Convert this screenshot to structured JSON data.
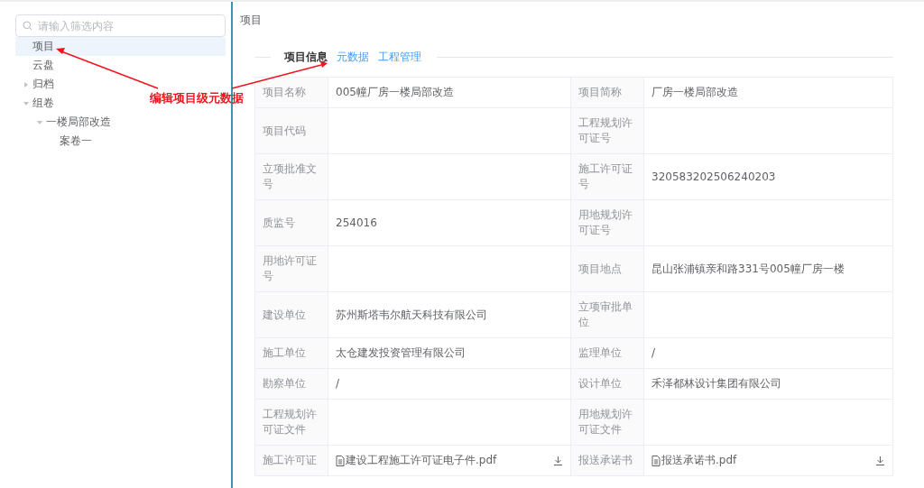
{
  "sidebar": {
    "search": {
      "placeholder": "请输入筛选内容"
    },
    "tree": [
      {
        "label": "项目",
        "selected": true
      },
      {
        "label": "云盘",
        "selected": false
      },
      {
        "label": "归档",
        "selected": false,
        "expanded": false
      },
      {
        "label": "组卷",
        "selected": false,
        "expanded": true,
        "children": [
          {
            "label": "一楼局部改造",
            "selected": false,
            "expanded": true,
            "children": [
              {
                "label": "案卷一",
                "selected": false
              }
            ]
          }
        ]
      }
    ]
  },
  "breadcrumb": "项目",
  "tabs": [
    {
      "label": "项目信息",
      "selected": true
    },
    {
      "label": "元数据",
      "selected": false
    },
    {
      "label": "工程管理",
      "selected": false
    }
  ],
  "fields": [
    [
      {
        "label": "项目名称",
        "value": "005幢厂房一楼局部改造"
      },
      {
        "label": "项目简称",
        "value": "厂房一楼局部改造"
      }
    ],
    [
      {
        "label": "项目代码"
      },
      {
        "label": "工程规划许可证号"
      }
    ],
    [
      {
        "label": "立项批准文号"
      },
      {
        "label": "施工许可证号",
        "value": "320583202506240203"
      }
    ],
    [
      {
        "label": "质监号",
        "value": "254016"
      },
      {
        "label": "用地规划许可证号"
      }
    ],
    [
      {
        "label": "用地许可证号"
      },
      {
        "label": "项目地点",
        "value": "昆山张浦镇亲和路331号005幢厂房一楼"
      }
    ],
    [
      {
        "label": "建设单位",
        "value": "苏州斯塔韦尔航天科技有限公司"
      },
      {
        "label": "立项审批单位"
      }
    ],
    [
      {
        "label": "施工单位",
        "value": "太仓建发投资管理有限公司"
      },
      {
        "label": "监理单位",
        "value": "/"
      }
    ],
    [
      {
        "label": "勘察单位",
        "value": "/"
      },
      {
        "label": "设计单位",
        "value": "禾泽都林设计集团有限公司"
      }
    ],
    [
      {
        "label": "工程规划许可证文件"
      },
      {
        "label": "用地规划许可证文件"
      }
    ],
    [
      {
        "label": "施工许可证",
        "value": "建设工程施工许可证电子件.pdf",
        "kind": "file"
      },
      {
        "label": "报送承诺书",
        "value": "报送承诺书.pdf",
        "kind": "file"
      }
    ]
  ],
  "annotation": {
    "text": "编辑项目级元数据"
  }
}
